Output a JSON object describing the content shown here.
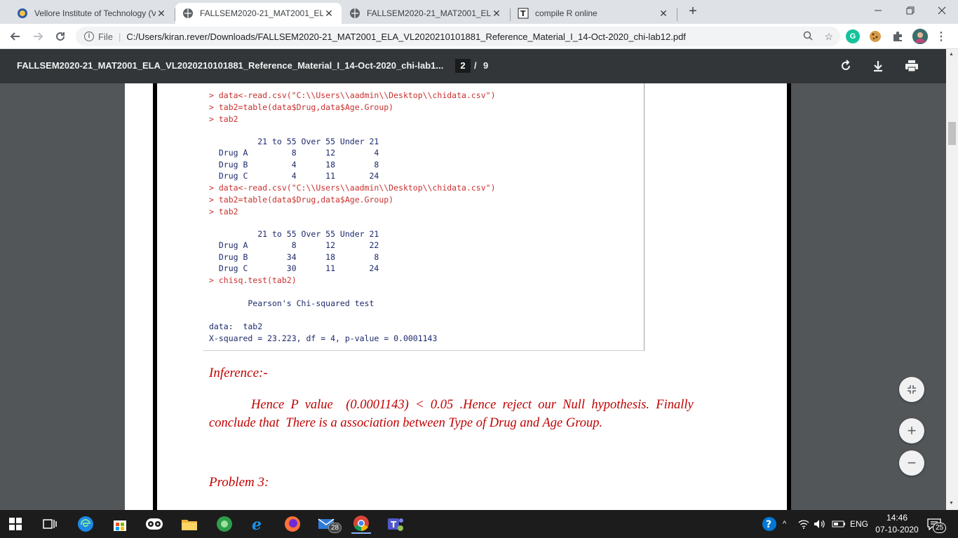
{
  "browser": {
    "tabs": [
      {
        "title": "Vellore Institute of Technology (V",
        "icon": "vit-icon",
        "active": false
      },
      {
        "title": "FALLSEM2020-21_MAT2001_ELA_",
        "icon": "globe-icon",
        "active": true
      },
      {
        "title": "FALLSEM2020-21_MAT2001_ELA_",
        "icon": "globe-icon",
        "active": false
      },
      {
        "title": "compile R online",
        "icon": "t-icon",
        "active": false
      }
    ],
    "new_tab": "+",
    "address": {
      "scheme_label": "File",
      "url": "C:/Users/kiran.rever/Downloads/FALLSEM2020-21_MAT2001_ELA_VL2020210101881_Reference_Material_I_14-Oct-2020_chi-lab12.pdf"
    },
    "extensions": [
      "grammarly-icon",
      "cookie-icon",
      "puzzle-icon",
      "profile-avatar"
    ]
  },
  "pdf_toolbar": {
    "title": "FALLSEM2020-21_MAT2001_ELA_VL2020210101881_Reference_Material_I_14-Oct-2020_chi-lab1...",
    "current_page": "2",
    "separator": "/",
    "total_pages": "9"
  },
  "console": {
    "block1": {
      "cmd1": "> data<-read.csv(\"C:\\\\Users\\\\aadmin\\\\Desktop\\\\chidata.csv\")",
      "cmd2": "> tab2=table(data$Drug,data$Age.Group)",
      "cmd3": "> tab2",
      "header": "          21 to 55 Over 55 Under 21",
      "row1": "  Drug A         8      12        4",
      "row2": "  Drug B         4      18        8",
      "row3": "  Drug C         4      11       24"
    },
    "block2": {
      "cmd1": "> data<-read.csv(\"C:\\\\Users\\\\aadmin\\\\Desktop\\\\chidata.csv\")",
      "cmd2": "> tab2=table(data$Drug,data$Age.Group)",
      "cmd3": "> tab2",
      "header": "          21 to 55 Over 55 Under 21",
      "row1": "  Drug A         8      12       22",
      "row2": "  Drug B        34      18        8",
      "row3": "  Drug C        30      11       24",
      "cmd4": "> chisq.test(tab2)",
      "test_title": "        Pearson's Chi-squared test",
      "data_line": "data:  tab2",
      "result_line": "X-squared = 23.223, df = 4, p-value = 0.0001143"
    }
  },
  "document": {
    "inference_heading": "Inference:-",
    "inference_line1": "Hence  P  value    (0.0001143)  <  0.05  .Hence  reject  our  Null  hypothesis.  Finally",
    "inference_line2": "conclude that  There is a association between Type of Drug and Age Group.",
    "problem_heading": "Problem 3:"
  },
  "zoom": {
    "fit": "fit-page-icon",
    "in": "+",
    "out": "−"
  },
  "taskbar": {
    "mail_badge": "28",
    "language": "ENG",
    "time": "14:46",
    "date": "07-10-2020",
    "notifications": "25"
  }
}
